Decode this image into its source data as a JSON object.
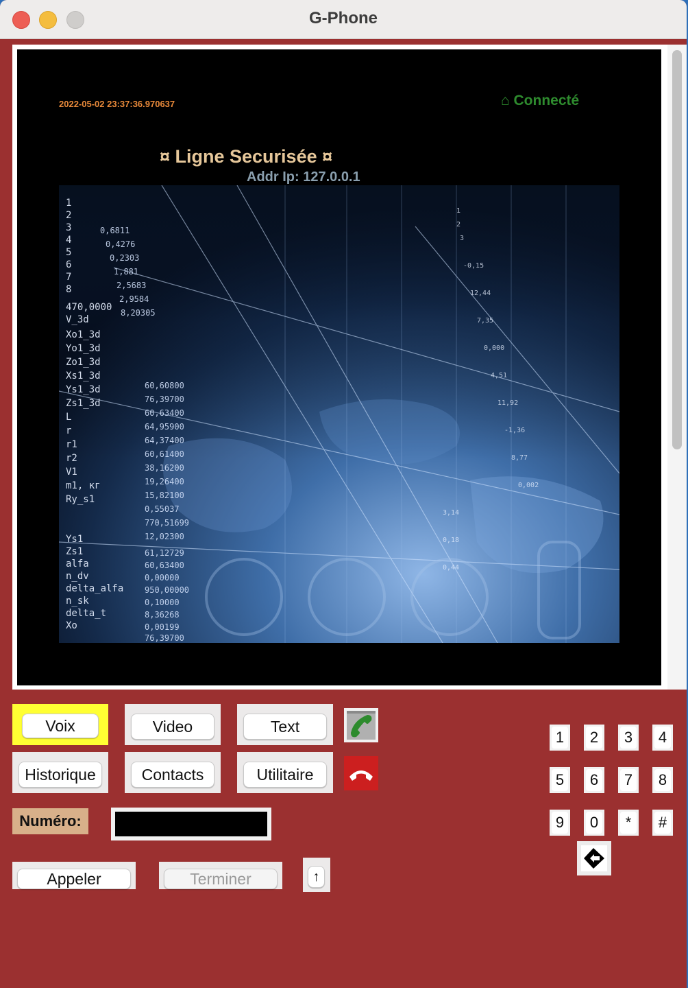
{
  "window": {
    "title": "G-Phone"
  },
  "screen": {
    "datetime": "2022-05-02 23:37:36.970637",
    "status": "⌂ Connecté",
    "secure_line": "¤ Ligne Securisée ¤",
    "addr": "Addr Ip: 127.0.0.1"
  },
  "mode_buttons": {
    "voix": "Voix",
    "video": "Video",
    "text": "Text",
    "historique": "Historique",
    "contacts": "Contacts",
    "utilitaire": "Utilitaire"
  },
  "icons": {
    "call": "phone-call-icon",
    "hangup": "hangup-icon",
    "up": "up-arrow-icon",
    "backspace": "backspace-icon"
  },
  "colors": {
    "window_bg": "#9b3030",
    "active_mode": "#ffff33",
    "status_green": "#2e8b2e",
    "datetime_orange": "#e8893a",
    "secure_line": "#e6c79a",
    "label_bg": "#d8b08a"
  },
  "numero": {
    "label": "Numéro:",
    "value": ""
  },
  "actions": {
    "appeler": "Appeler",
    "terminer": "Terminer",
    "up": "↑"
  },
  "keypad": {
    "row1": [
      "1",
      "2",
      "3",
      "4"
    ],
    "row2": [
      "5",
      "6",
      "7",
      "8"
    ],
    "row3": [
      "9",
      "0",
      "*",
      "#"
    ]
  }
}
